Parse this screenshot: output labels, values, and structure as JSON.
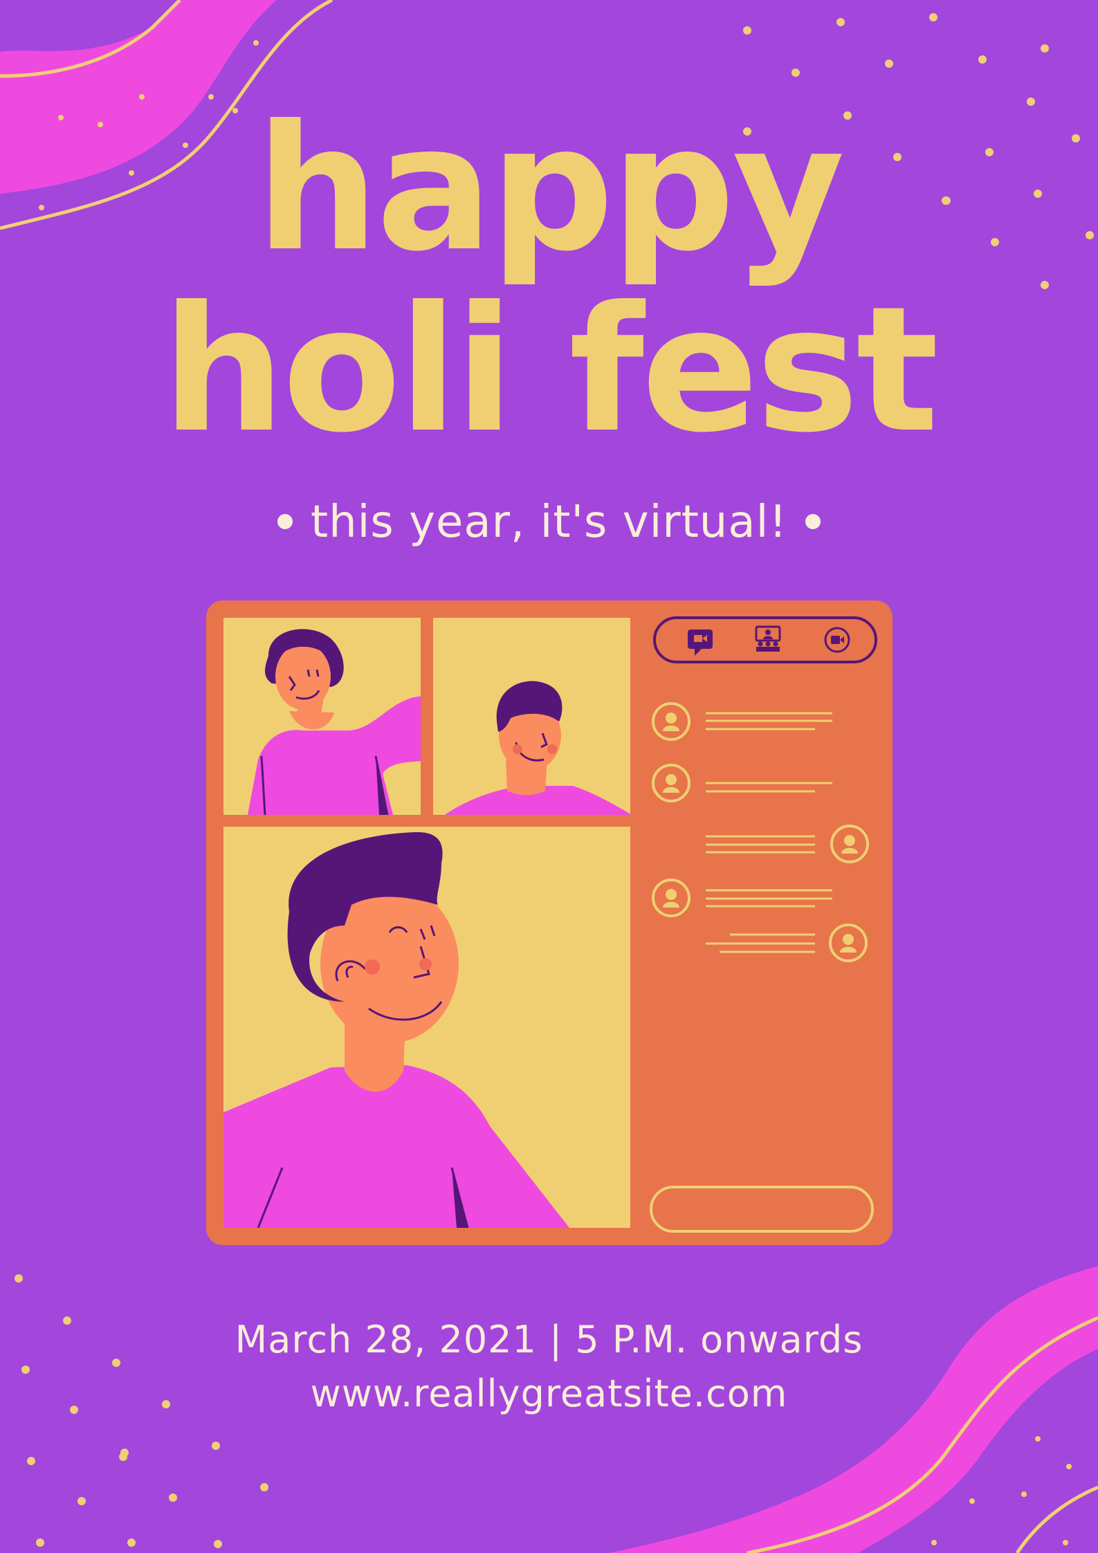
{
  "poster": {
    "title_line1": "happy",
    "title_line2": "holi fest",
    "subtitle": "this year, it's virtual!",
    "event_datetime": "March 28, 2021 | 5 P.M. onwards",
    "website": "www.reallygreatsite.com"
  },
  "colors": {
    "background": "#a246dc",
    "title": "#f0cf73",
    "text": "#fbeed9",
    "wave_pink": "#ef4ae0",
    "window_frame": "#e7744b",
    "tile_bg": "#f0cf73",
    "hair": "#561678",
    "skin": "#fb8c5f",
    "shirt": "#ef4ae0"
  },
  "icons": [
    "chat-icon",
    "participants-icon",
    "video-camera-icon",
    "avatar-icon"
  ]
}
